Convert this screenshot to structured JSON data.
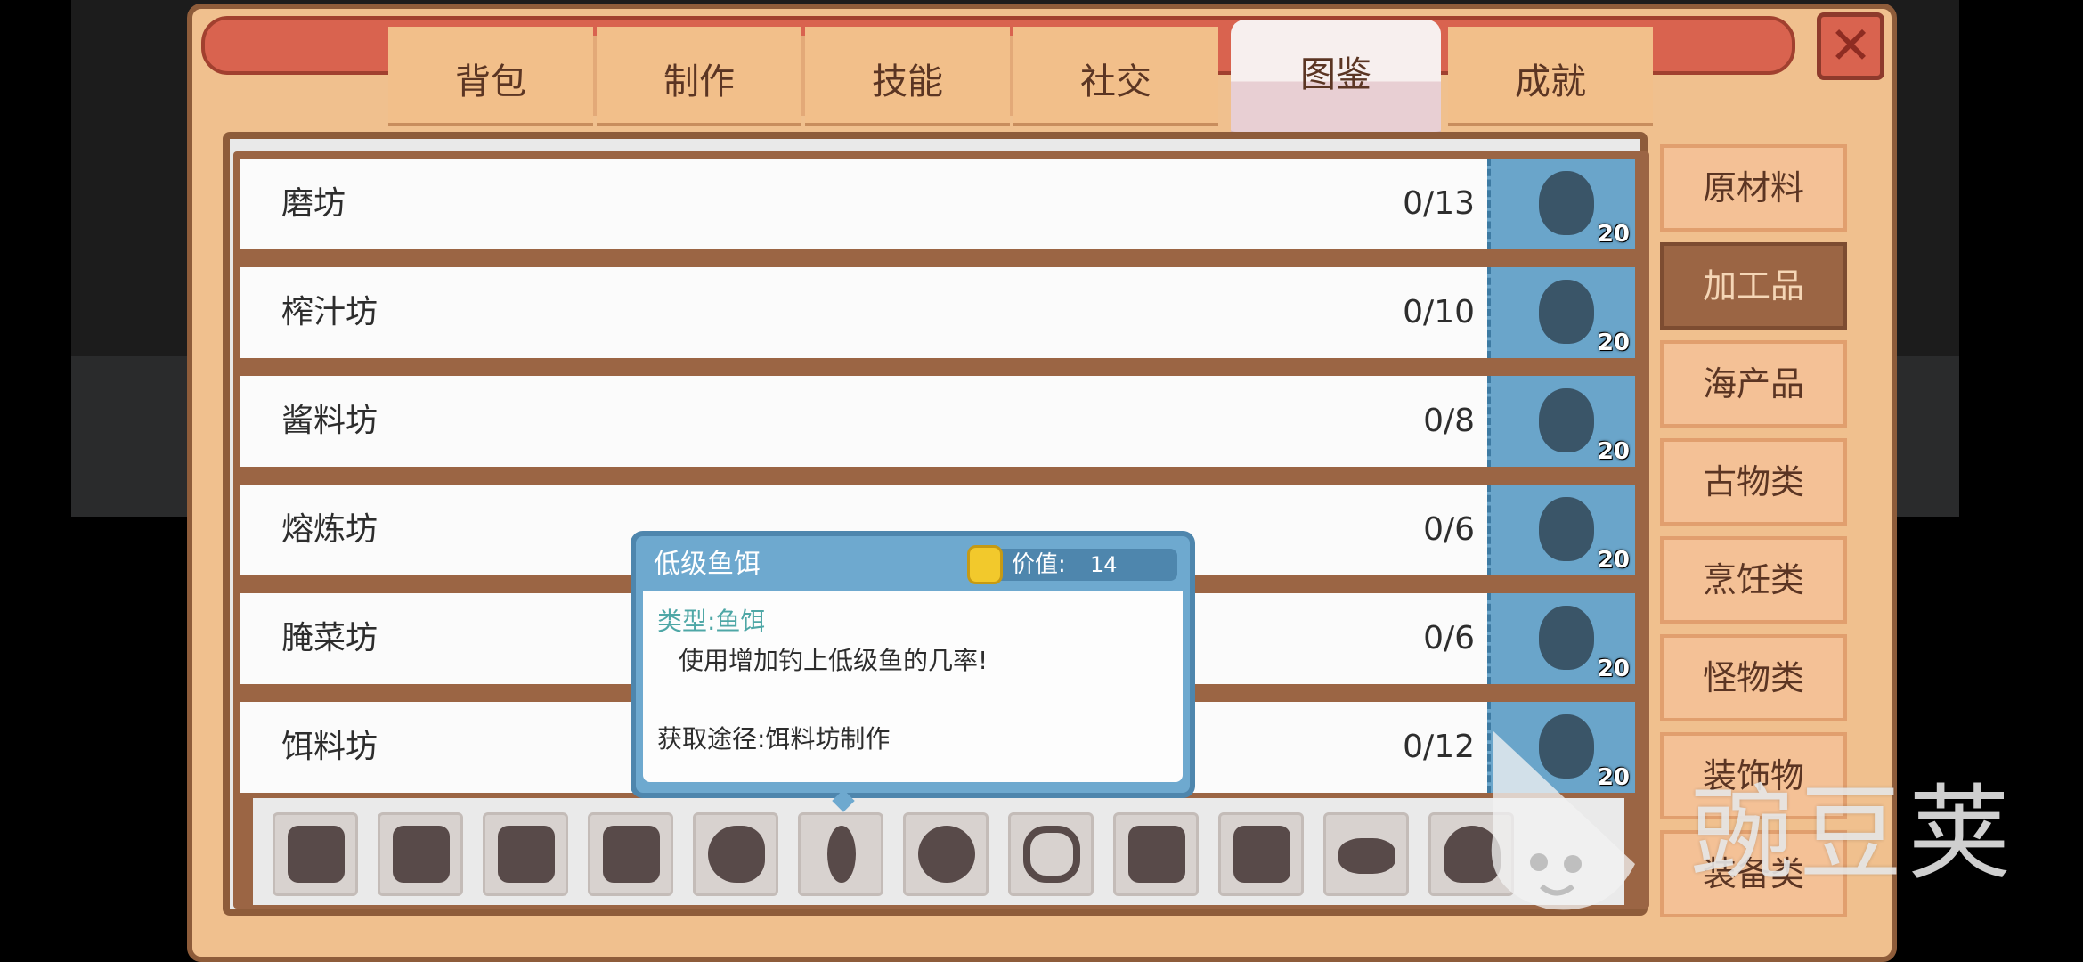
{
  "tabs": [
    {
      "label": "背包",
      "active": false
    },
    {
      "label": "制作",
      "active": false
    },
    {
      "label": "技能",
      "active": false
    },
    {
      "label": "社交",
      "active": false
    },
    {
      "label": "图鉴",
      "active": true
    },
    {
      "label": "成就",
      "active": false
    }
  ],
  "rows": [
    {
      "name": "磨坊",
      "count": "0/13",
      "badge": "20"
    },
    {
      "name": "榨汁坊",
      "count": "0/10",
      "badge": "20"
    },
    {
      "name": "酱料坊",
      "count": "0/8",
      "badge": "20"
    },
    {
      "name": "熔炼坊",
      "count": "0/6",
      "badge": "20"
    },
    {
      "name": "腌菜坊",
      "count": "0/6",
      "badge": "20"
    },
    {
      "name": "饵料坊",
      "count": "0/12",
      "badge": "20"
    }
  ],
  "categories": [
    {
      "label": "原材料",
      "active": false
    },
    {
      "label": "加工品",
      "active": true
    },
    {
      "label": "海产品",
      "active": false
    },
    {
      "label": "古物类",
      "active": false
    },
    {
      "label": "烹饪类",
      "active": false
    },
    {
      "label": "怪物类",
      "active": false
    },
    {
      "label": "装饰物",
      "active": false
    },
    {
      "label": "装备类",
      "active": false
    }
  ],
  "tooltip": {
    "title": "低级鱼饵",
    "value_label": "价值:",
    "value": "14",
    "type": "类型:鱼饵",
    "description": "使用增加钓上低级鱼的几率!",
    "source": "获取途径:饵料坊制作"
  },
  "watermark": {
    "text": "豌豆荚"
  },
  "colors": {
    "panel": "#f0c08e",
    "frame": "#8e5c3a",
    "accent_blue": "#6aa5ca",
    "active_category": "#9b6544",
    "close_red": "#d9634f"
  }
}
